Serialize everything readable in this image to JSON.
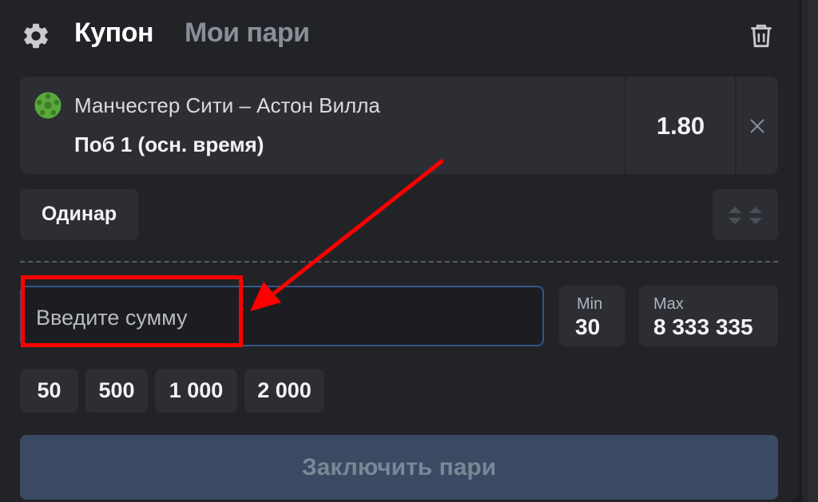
{
  "header": {
    "tab_coupon": "Купон",
    "tab_my_bets": "Мои пари",
    "settings_icon": "gear-icon",
    "delete_icon": "trash-icon"
  },
  "bet": {
    "match": "Манчестер Сити – Астон Вилла",
    "outcome": "Поб 1 (осн. время)",
    "odds": "1.80",
    "sport_icon": "football-icon",
    "remove_icon": "close-icon"
  },
  "bet_type": {
    "label": "Одинар",
    "toggle_icon": "expand-collapse-icon"
  },
  "stake": {
    "placeholder": "Введите сумму",
    "min_label": "Min",
    "min_value": "30",
    "max_label": "Max",
    "max_value": "8 333 335"
  },
  "quick_amounts": [
    "50",
    "500",
    "1 000",
    "2 000"
  ],
  "submit_label": "Заключить пари",
  "colors": {
    "background": "#222327",
    "card": "#2d2e34",
    "input_border": "#345789",
    "submit_bg": "#394a62",
    "highlight": "#ff0000",
    "ball_green": "#5aa83c"
  }
}
